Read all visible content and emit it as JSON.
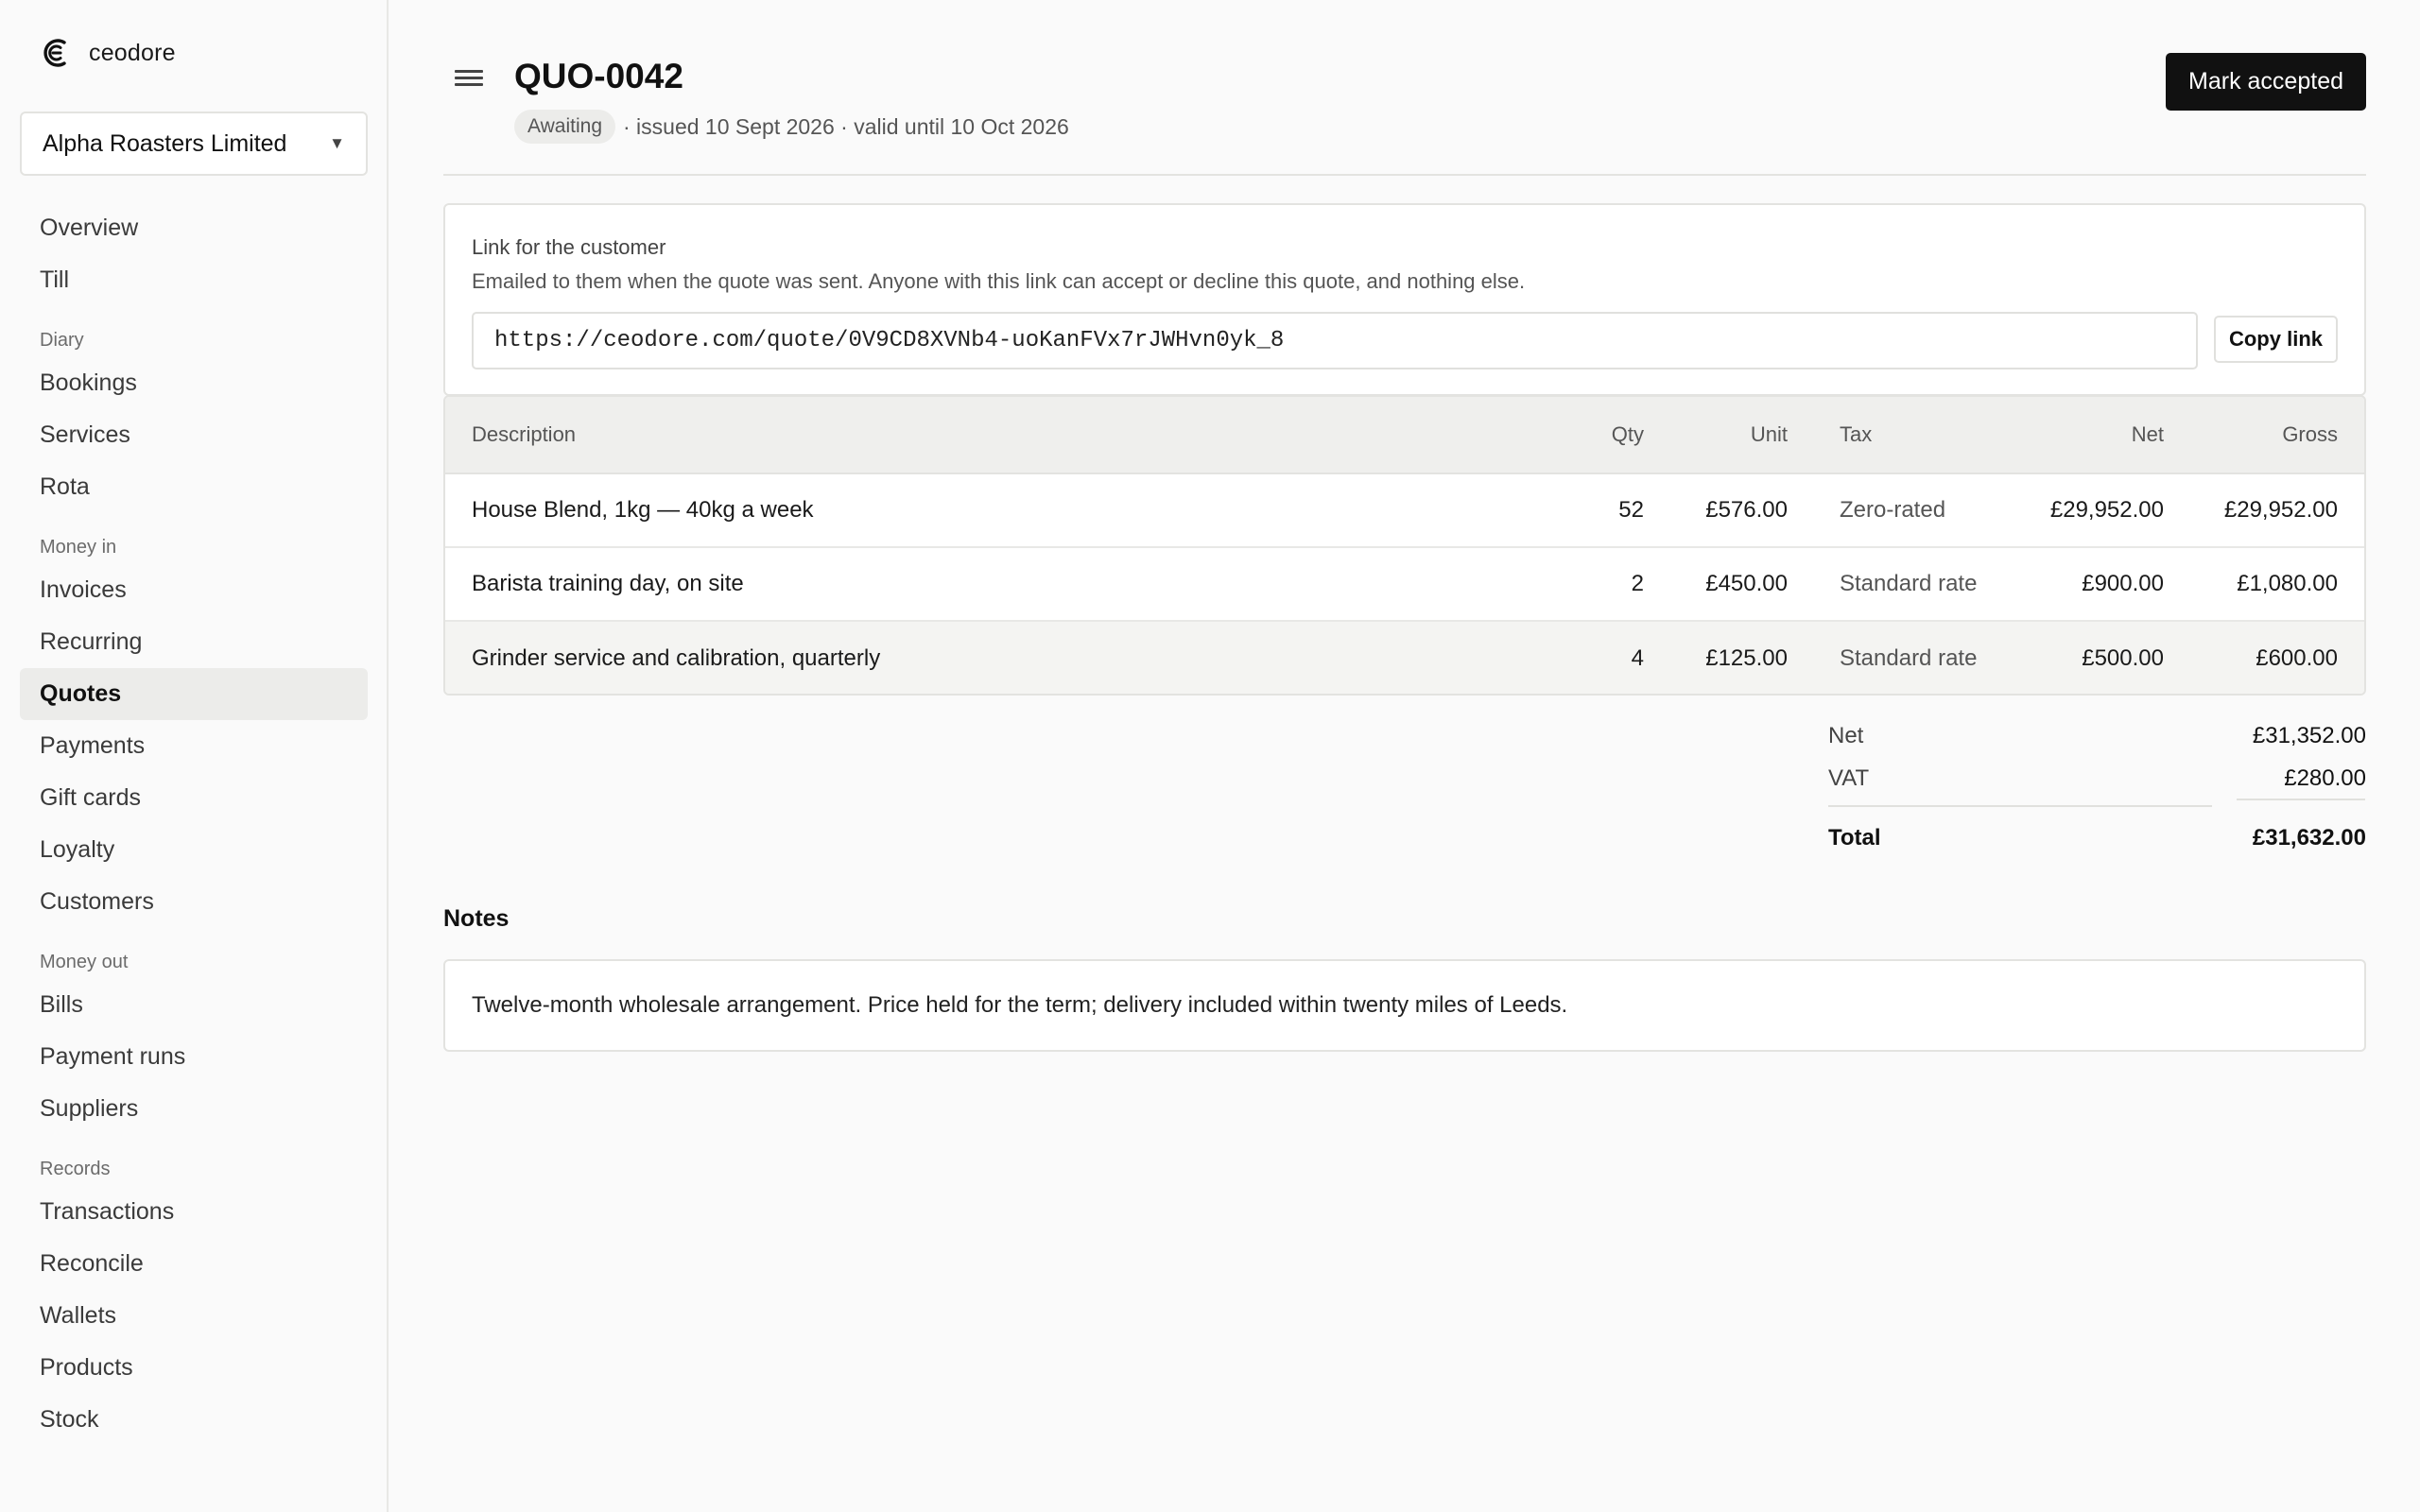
{
  "brand": {
    "name": "ceodore",
    "logo_icon": "ceodore-logo-icon"
  },
  "org": {
    "name": "Alpha Roasters Limited"
  },
  "nav": {
    "top": [
      {
        "label": "Overview"
      },
      {
        "label": "Till"
      }
    ],
    "sections": [
      {
        "title": "Diary",
        "items": [
          {
            "label": "Bookings"
          },
          {
            "label": "Services"
          },
          {
            "label": "Rota"
          }
        ]
      },
      {
        "title": "Money in",
        "items": [
          {
            "label": "Invoices"
          },
          {
            "label": "Recurring"
          },
          {
            "label": "Quotes",
            "active": true
          },
          {
            "label": "Payments"
          },
          {
            "label": "Gift cards"
          },
          {
            "label": "Loyalty"
          },
          {
            "label": "Customers"
          }
        ]
      },
      {
        "title": "Money out",
        "items": [
          {
            "label": "Bills"
          },
          {
            "label": "Payment runs"
          },
          {
            "label": "Suppliers"
          }
        ]
      },
      {
        "title": "Records",
        "items": [
          {
            "label": "Transactions"
          },
          {
            "label": "Reconcile"
          },
          {
            "label": "Wallets"
          },
          {
            "label": "Products"
          },
          {
            "label": "Stock"
          }
        ]
      }
    ]
  },
  "header": {
    "title": "QUO-0042",
    "status": "Awaiting",
    "meta": "· issued 10 Sept 2026 · valid until 10 Oct 2026",
    "primary_action": "Mark accepted"
  },
  "link_card": {
    "title": "Link for the customer",
    "description": "Emailed to them when the quote was sent. Anyone with this link can accept or decline this quote, and nothing else.",
    "url": "https://ceodore.com/quote/0V9CD8XVNb4-uoKanFVx7rJWHvn0yk_8",
    "copy_label": "Copy link"
  },
  "table": {
    "headers": {
      "description": "Description",
      "qty": "Qty",
      "unit": "Unit",
      "tax": "Tax",
      "net": "Net",
      "gross": "Gross"
    },
    "rows": [
      {
        "description": "House Blend, 1kg — 40kg a week",
        "qty": "52",
        "unit": "£576.00",
        "tax": "Zero-rated",
        "net": "£29,952.00",
        "gross": "£29,952.00"
      },
      {
        "description": "Barista training day, on site",
        "qty": "2",
        "unit": "£450.00",
        "tax": "Standard rate",
        "net": "£900.00",
        "gross": "£1,080.00"
      },
      {
        "description": "Grinder service and calibration, quarterly",
        "qty": "4",
        "unit": "£125.00",
        "tax": "Standard rate",
        "net": "£500.00",
        "gross": "£600.00"
      }
    ]
  },
  "totals": {
    "net_label": "Net",
    "net": "£31,352.00",
    "vat_label": "VAT",
    "vat": "£280.00",
    "total_label": "Total",
    "total": "£31,632.00"
  },
  "notes": {
    "heading": "Notes",
    "text": "Twelve-month wholesale arrangement. Price held for the term; delivery included within twenty miles of Leeds."
  }
}
